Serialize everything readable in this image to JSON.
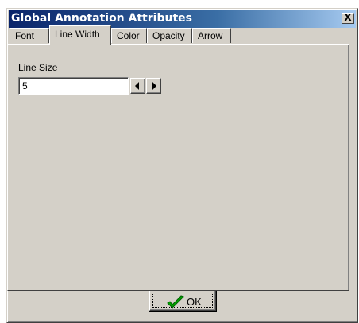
{
  "window": {
    "title": "Global Annotation Attributes",
    "close_glyph": "X"
  },
  "tabs": [
    {
      "label": "Font",
      "active": false
    },
    {
      "label": "Line Width",
      "active": true
    },
    {
      "label": "Color",
      "active": false
    },
    {
      "label": "Opacity",
      "active": false
    },
    {
      "label": "Arrow",
      "active": false
    }
  ],
  "line_width": {
    "label": "Line Size",
    "value": "5",
    "decrement_icon": "arrow-left-icon",
    "increment_icon": "arrow-right-icon"
  },
  "footer": {
    "ok_label": "OK",
    "ok_icon": "check-icon",
    "ok_icon_color": "#00a000"
  },
  "colors": {
    "title_start": "#0a246a",
    "title_end": "#a6caf0",
    "face": "#d4d0c8"
  }
}
